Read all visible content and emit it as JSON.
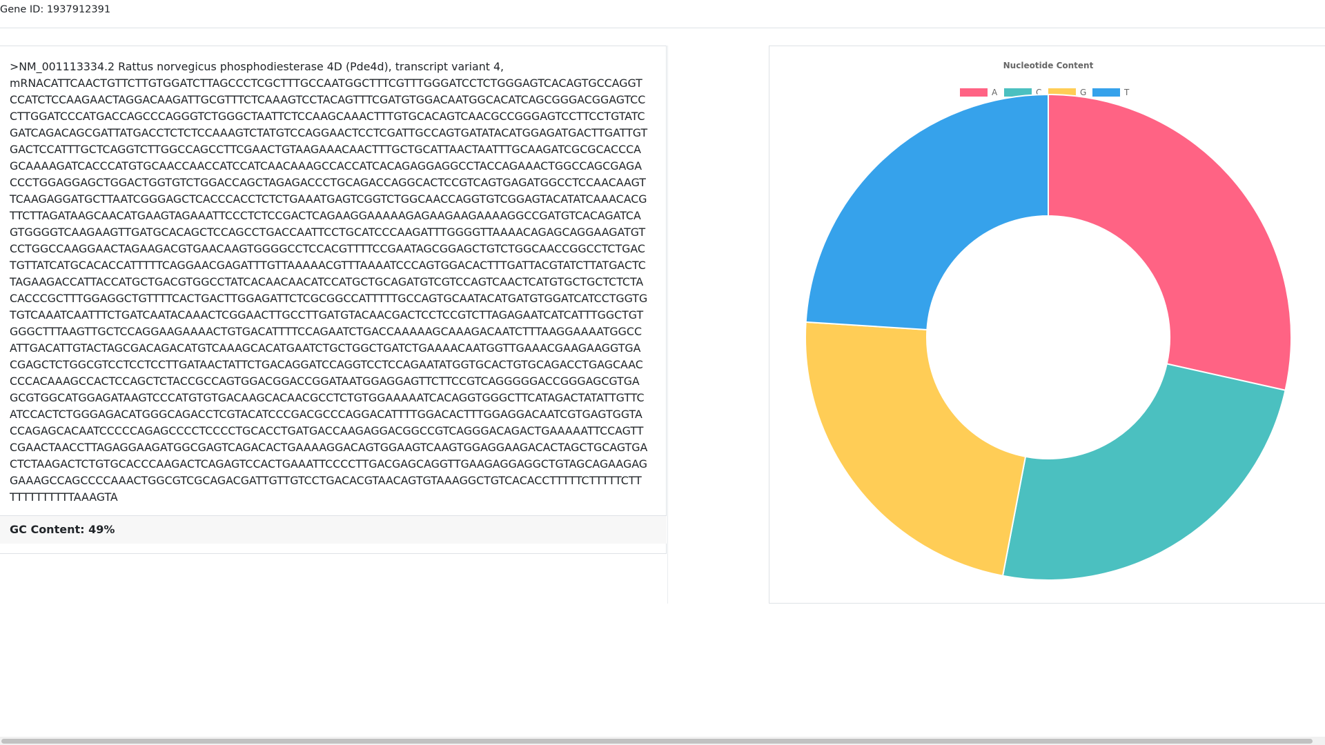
{
  "header": {
    "gene_id": "Gene ID: 1937912391"
  },
  "sequence": {
    "text": ">NM_001113334.2 Rattus norvegicus phosphodiesterase 4D (Pde4d), transcript variant 4,\nmRNACATTCAACTGTTCTTGTGGATCTTAGCCCTCGCTTTGCCAATGGCTTTCGTTTGGGATCCTCTGGGAGTCACAGTGCCAGGT\nCCATCTCCAAGAACTAGGACAAGATTGCGTTTCTCAAAGTCCTACAGTTTCGATGTGGACAATGGCACATCAGCGGGACGGAGTCC\nCTTGGATCCCATGACCAGCCCAGGGTCTGGGCTAATTCTCCAAGCAAACTTTGTGCACAGTCAACGCCGGGAGTCCTTCCTGTATC\nGATCAGACAGCGATTATGACCTCTCTCCAAAGTCTATGTCCAGGAACTCCTCGATTGCCAGTGATATACATGGAGATGACTTGATTGT\nGACTCCATTTGCTCAGGTCTTGGCCAGCCTTCGAACTGTAAGAAACAACTTTGCTGCATTAACTAATTTGCAAGATCGCGCACCCA\nGCAAAAGATCACCCATGTGCAACCAACCATCCATCAACAAAGCCACCATCACAGAGGAGGCCTACCAGAAACTGGCCAGCGAGA\nCCCTGGAGGAGCTGGACTGGTGTCTGGACCAGCTAGAGACCCTGCAGACCAGGCACTCCGTCAGTGAGATGGCCTCCAACAAGT\nTCAAGAGGATGCTTAATCGGGAGCTCACCCACCTCTCTGAAATGAGTCGGTCTGGCAACCAGGTGTCGGAGTACATATCAAACACG\nTTCTTAGATAAGCAACATGAAGTAGAAATTCCCTCTCCGACTCAGAAGGAAAAAGAGAAGAAGAAAAGGCCGATGTCACAGATCA\nGTGGGGTCAAGAAGTTGATGCACAGCTCCAGCCTGACCAATTCCTGCATCCCAAGATTTGGGGTTAAAACAGAGCAGGAAGATGT\nCCTGGCCAAGGAACTAGAAGACGTGAACAAGTGGGGCCTCCACGTTTTCCGAATAGCGGAGCTGTCTGGCAACCGGCCTCTGAC\nTGTTATCATGCACACCATTTTTCAGGAACGAGATTTGTTAAAAACGTTTAAAATCCCAGTGGACACTTTGATTACGTATCTTATGACTC\nTAGAAGACCATTACCATGCTGACGTGGCCTATCACAACAACATCCATGCTGCAGATGTCGTCCAGTCAACTCATGTGCTGCTCTCTA\nCACCCGCTTTGGAGGCTGTTTTCACTGACTTGGAGATTCTCGCGGCCATTTTTGCCAGTGCAATACATGATGTGGATCATCCTGGTG\nTGTCAAATCAATTTCTGATCAATACAAACTCGGAACTTGCCTTGATGTACAACGACTCCTCCGTCTTAGAGAATCATCATTTGGCTGT\nGGGCTTTAAGTTGCTCCAGGAAGAAAACTGTGACATTTTCCAGAATCTGACCAAAAAGCAAAGACAATCTTTAAGGAAAATGGCC\nATTGACATTGTACTAGCGACAGACATGTCAAAGCACATGAATCTGCTGGCTGATCTGAAAACAATGGTTGAAACGAAGAAGGTGA\nCGAGCTCTGGCGTCCTCCTCCTTGATAACTATTCTGACAGGATCCAGGTCCTCCAGAATATGGTGCACTGTGCAGACCTGAGCAAC\nCCCACAAAGCCACTCCAGCTCTACCGCCAGTGGACGGACCGGATAATGGAGGAGTTCTTCCGTCAGGGGGACCGGGAGCGTGA\nGCGTGGCATGGAGATAAGTCCCATGTGTGACAAGCACAACGCCTCTGTGGAAAAATCACAGGTGGGCTTCATAGACTATATTGTTC\nATCCACTCTGGGAGACATGGGCAGACCTCGTACATCCCGACGCCCAGGACATTTTGGACACTTTGGAGGACAATCGTGAGTGGTA\nCCAGAGCACAATCCCCCAGAGCCCCTCCCCTGCACCTGATGACCAAGAGGACGGCCGTCAGGGACAGACTGAAAAATTCCAGTT\nCGAACTAACCTTAGAGGAAGATGGCGAGTCAGACACTGAAAAGGACAGTGGAAGTCAAGTGGAGGAAGACACTAGCTGCAGTGA\nCTCTAAGACTCTGTGCACCCAAGACTCAGAGTCCACTGAAATTCCCCTTGACGAGCAGGTTGAAGAGGAGGCTGTAGCAGAAGAG\nGAAAGCCAGCCCCAAACTGGCGTCGCAGACGATTGTTGTCCTGACACGTAACAGTGTAAAGGCTGTCACACCTTTTTCTTTTTCTT\nTTTTTTTTTTAAAGTA"
  },
  "gc": {
    "label": "GC Content: 49%"
  },
  "colors": {
    "A": "#ff6384",
    "C": "#4bc0c0",
    "G": "#ffcd56",
    "T": "#36a2eb"
  },
  "chart_data": {
    "type": "pie",
    "donut": true,
    "title": "Nucleotide Content",
    "legend_position": "top",
    "categories": [
      "A",
      "C",
      "G",
      "T"
    ],
    "values": [
      28.5,
      24.5,
      23.0,
      24.0
    ],
    "unit": "%"
  }
}
